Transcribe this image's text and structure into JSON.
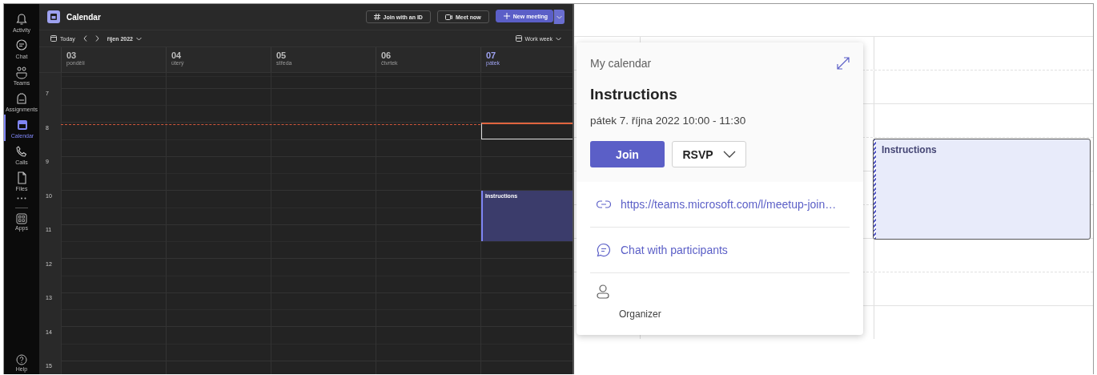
{
  "rail": [
    {
      "label": "Activity",
      "selected": false
    },
    {
      "label": "Chat",
      "selected": false
    },
    {
      "label": "Teams",
      "selected": false
    },
    {
      "label": "Assignments",
      "selected": false
    },
    {
      "label": "Calendar",
      "selected": true
    },
    {
      "label": "Calls",
      "selected": false
    },
    {
      "label": "Files",
      "selected": false
    }
  ],
  "rail_apps": {
    "label": "Apps"
  },
  "rail_help": {
    "label": "Help"
  },
  "header": {
    "title": "Calendar",
    "buttons": [
      {
        "label": "Join with an ID",
        "kind": "hash"
      },
      {
        "label": "Meet now",
        "kind": "video"
      },
      {
        "label": "New meeting",
        "kind": "primary"
      }
    ]
  },
  "toolbar": {
    "today": "Today",
    "month": "říjen 2022",
    "view": "Work week"
  },
  "calendar": {
    "days": [
      {
        "number": "03",
        "name": "pondělí",
        "selected": false
      },
      {
        "number": "04",
        "name": "úterý",
        "selected": false
      },
      {
        "number": "05",
        "name": "středa",
        "selected": false
      },
      {
        "number": "06",
        "name": "čtvrtek",
        "selected": false
      },
      {
        "number": "07",
        "name": "pátek",
        "selected": true,
        "events": [
          {
            "title": "Instructions"
          }
        ]
      }
    ],
    "hours": [
      "7",
      "8",
      "9",
      "10",
      "11",
      "12",
      "13",
      "14",
      "15"
    ]
  },
  "popup": {
    "calendar": "My calendar",
    "title": "Instructions",
    "when": "pátek 7. října 2022 10:00 - 11:30",
    "join": "Join",
    "rsvp": "RSVP",
    "items": [
      {
        "kind": "link",
        "text": "https://teams.microsoft.com/l/meetup-join…"
      },
      {
        "kind": "chat",
        "text": "Chat with participants"
      },
      {
        "kind": "person",
        "text": "Organizer"
      }
    ]
  },
  "zoomed_event": {
    "title": "Instructions"
  }
}
